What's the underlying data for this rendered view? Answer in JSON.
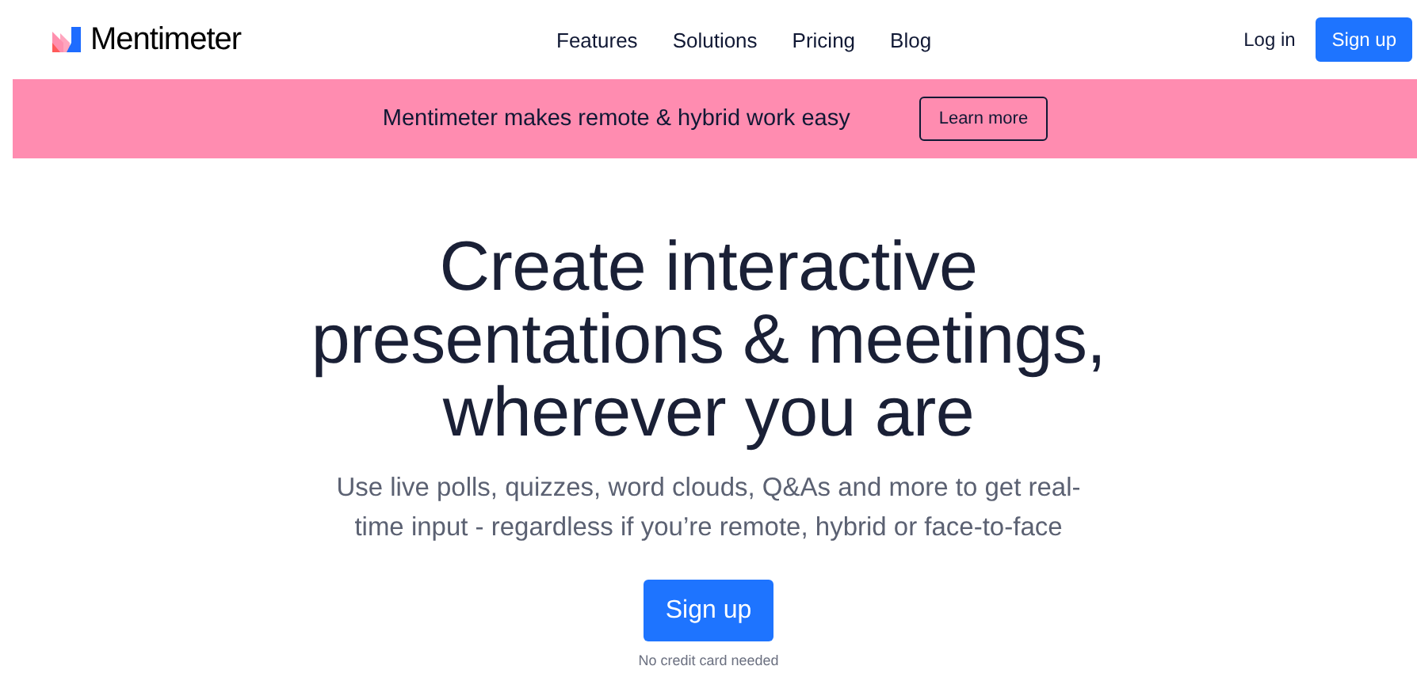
{
  "header": {
    "logo": "Mentimeter",
    "nav": [
      "Features",
      "Solutions",
      "Pricing",
      "Blog"
    ],
    "login": "Log in",
    "signup": "Sign up"
  },
  "banner": {
    "text": "Mentimeter makes remote & hybrid work easy",
    "button": "Learn more"
  },
  "hero": {
    "title": "Create interactive presentations & meetings, wherever you are",
    "subtitle": "Use live polls, quizzes, word clouds, Q&As and more to get real-time input - regardless if you’re remote, hybrid or face-to-face",
    "button": "Sign up",
    "note": "No credit card needed"
  }
}
